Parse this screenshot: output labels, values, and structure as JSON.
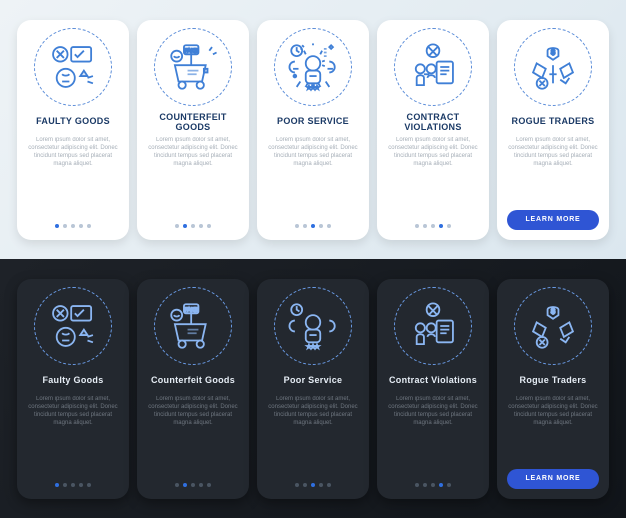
{
  "placeholder": "Lorem ipsum dolor sit amet, consectetur adipiscing elit. Donec tincidunt tempus sed placerat magna aliquet.",
  "cta_label": "LEARN MORE",
  "light": {
    "cards": [
      {
        "title": "FAULTY GOODS",
        "icon": "faulty-goods-icon"
      },
      {
        "title": "COUNTERFEIT GOODS",
        "icon": "counterfeit-goods-icon"
      },
      {
        "title": "POOR SERVICE",
        "icon": "poor-service-icon"
      },
      {
        "title": "CONTRACT VIOLATIONS",
        "icon": "contract-violations-icon"
      },
      {
        "title": "ROGUE TRADERS",
        "icon": "rogue-traders-icon"
      }
    ]
  },
  "dark": {
    "cards": [
      {
        "title": "Faulty Goods",
        "icon": "faulty-goods-icon"
      },
      {
        "title": "Counterfeit Goods",
        "icon": "counterfeit-goods-icon"
      },
      {
        "title": "Poor Service",
        "icon": "poor-service-icon"
      },
      {
        "title": "Contract Violations",
        "icon": "contract-violations-icon"
      },
      {
        "title": "Rogue Traders",
        "icon": "rogue-traders-icon"
      }
    ]
  },
  "colors": {
    "stroke_light": "#3f7fd6",
    "stroke_dark": "#8bb6f2",
    "accent": "#2f55d4"
  }
}
